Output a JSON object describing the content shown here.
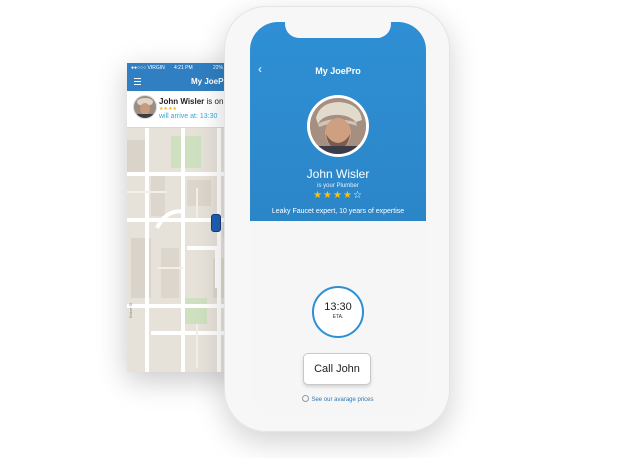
{
  "background_map_screen": {
    "status_bar": {
      "carrier": "●●○○○ VIRGIN",
      "time": "4:21 PM",
      "battery": "22% ▭"
    },
    "nav": {
      "title": "My JoePro",
      "menu_icon": "hamburger-icon"
    },
    "notification": {
      "message": "John Wisler is on his w",
      "name": "John Wisler",
      "rest": " is on his w",
      "stars": "★★★★",
      "arrival": "will arrive at: 13:30"
    },
    "map": {
      "vehicle_icon": "car-icon",
      "road_label": "Baker St"
    }
  },
  "foreground_profile_screen": {
    "back_icon": "back-chevron-icon",
    "back_glyph": "‹",
    "title": "My JoePro",
    "name": "John Wisler",
    "role": "is your Plumber",
    "rating": {
      "filled": "★★★★",
      "empty": "☆",
      "value": 4,
      "max": 5
    },
    "description": "Leaky Faucet expert, 10 years of expertise",
    "eta": {
      "time": "13:30",
      "label": "ETA."
    },
    "call_button": "Call John",
    "prices_link": "See our avarage prices"
  },
  "colors": {
    "brand_blue": "#2b88cb",
    "star": "#f3c317",
    "link_blue": "#2a78b8"
  }
}
